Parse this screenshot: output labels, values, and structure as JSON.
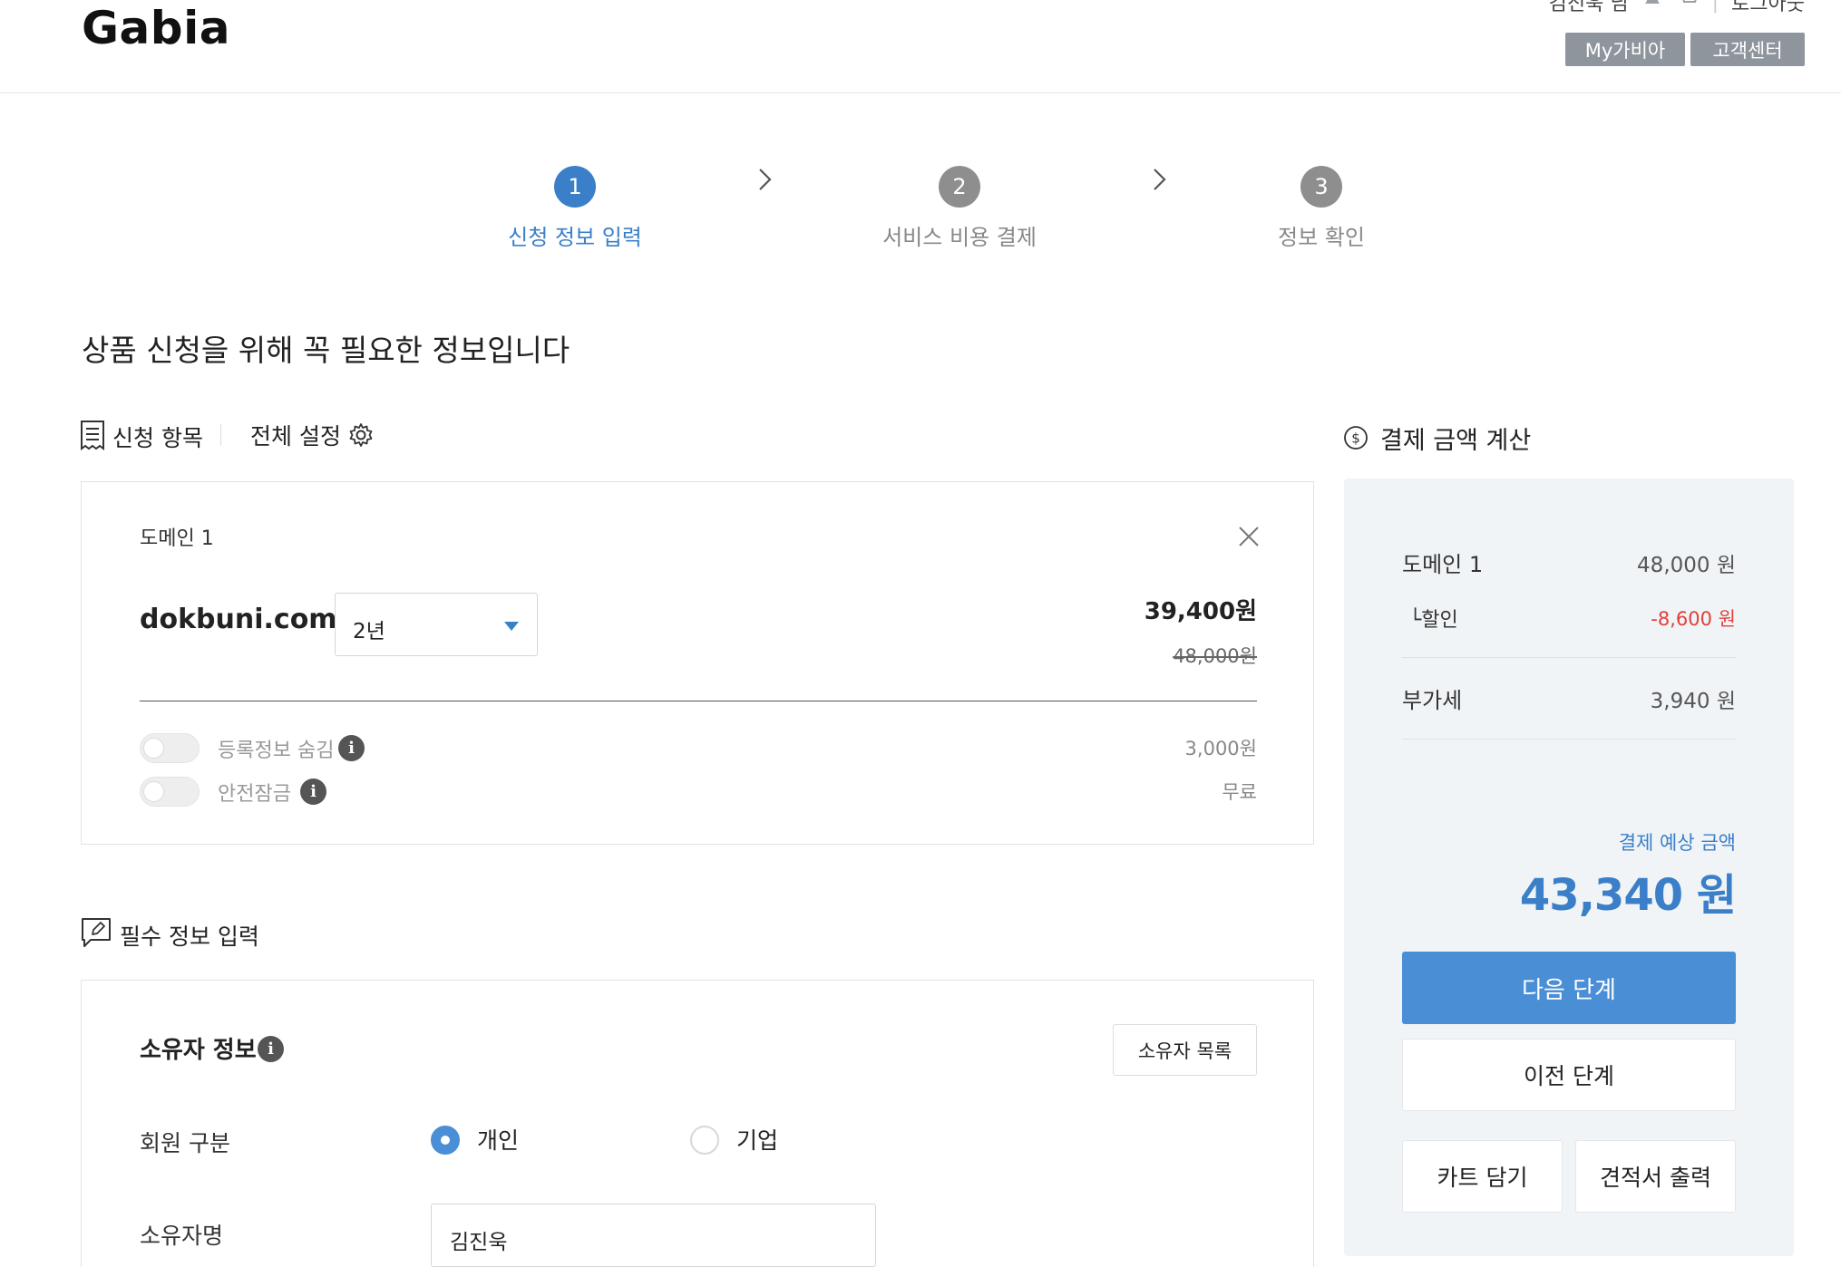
{
  "header": {
    "logo": "Gabia",
    "user_name": "김진욱 님",
    "logout": "로그아웃",
    "my_gabia": "My가비아",
    "customer_center": "고객센터"
  },
  "stepper": {
    "steps": [
      {
        "number": "1",
        "label": "신청 정보 입력",
        "active": true
      },
      {
        "number": "2",
        "label": "서비스 비용 결제",
        "active": false
      },
      {
        "number": "3",
        "label": "정보 확인",
        "active": false
      }
    ]
  },
  "page_heading": "상품 신청을 위해 꼭 필요한 정보입니다",
  "application": {
    "section_title": "신청 항목",
    "global_settings": "전체 설정",
    "domain_label": "도메인 1",
    "domain_name": "dokbuni.com",
    "period_selected": "2년",
    "price": "39,400원",
    "original_price": "48,000원",
    "options": [
      {
        "label": "등록정보 숨김",
        "price": "3,000원",
        "enabled": false
      },
      {
        "label": "안전잠금",
        "price": "무료",
        "enabled": false
      }
    ]
  },
  "required_info": {
    "section_title": "필수 정보 입력",
    "owner_title": "소유자 정보",
    "owner_list_button": "소유자 목록",
    "member_type_label": "회원 구분",
    "member_type_options": [
      {
        "label": "개인",
        "selected": true
      },
      {
        "label": "기업",
        "selected": false
      }
    ],
    "owner_name_label": "소유자명",
    "owner_name_value": "김진욱"
  },
  "summary": {
    "title": "결제 금액 계산",
    "rows": [
      {
        "label": "도메인 1",
        "value": "48,000 원"
      },
      {
        "label": "└할인",
        "value": "-8,600 원"
      },
      {
        "label": "부가세",
        "value": "3,940 원"
      }
    ],
    "estimated_label": "결제 예상 금액",
    "estimated_total": "43,340 원",
    "next_button": "다음 단계",
    "prev_button": "이전 단계",
    "cart_button": "카트 담기",
    "quote_button": "견적서 출력"
  },
  "colors": {
    "accent_blue": "#3a7fc8",
    "button_blue": "#4a8ed6",
    "discount_red": "#e0413a",
    "header_button_gray": "#8f959d",
    "summary_bg": "#f1f4f7"
  }
}
